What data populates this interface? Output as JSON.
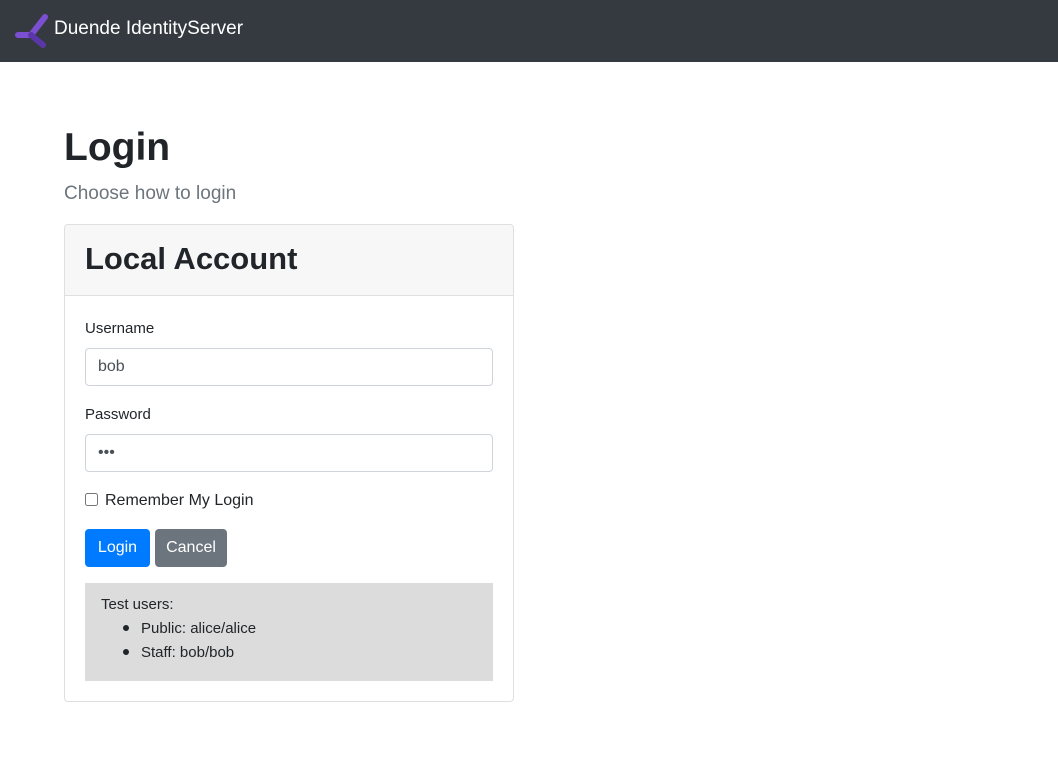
{
  "navbar": {
    "brand": "Duende IdentityServer",
    "logo_icon": "duende-logo-icon",
    "colors": {
      "background": "#343a40",
      "logo": "#7b4fd1"
    }
  },
  "page": {
    "title": "Login",
    "subtitle": "Choose how to login"
  },
  "local_account": {
    "title": "Local Account",
    "username_label": "Username",
    "username_value": "bob",
    "password_label": "Password",
    "password_value": "bob",
    "remember_label": "Remember My Login",
    "remember_checked": false,
    "login_button": "Login",
    "cancel_button": "Cancel",
    "test_users": {
      "title": "Test users:",
      "items": [
        "Public: alice/alice",
        "Staff: bob/bob"
      ]
    }
  },
  "colors": {
    "primary": "#007bff",
    "secondary": "#6c757d",
    "info_background": "#dcdcdc"
  }
}
